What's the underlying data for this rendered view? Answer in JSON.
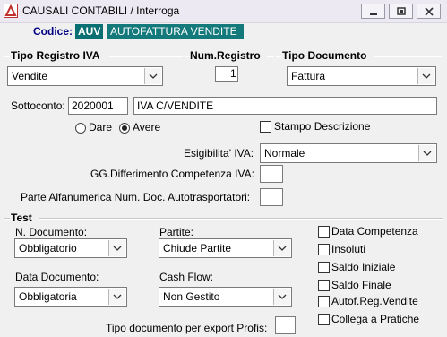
{
  "window": {
    "title": "CAUSALI CONTABILI / Interroga"
  },
  "codice": {
    "label": "Codice:",
    "code": "AUV",
    "description": "AUTOFATTURA VENDITE"
  },
  "tipo_registro": {
    "label": "Tipo Registro IVA",
    "value": "Vendite"
  },
  "num_registro": {
    "label": "Num.Registro",
    "value": "1"
  },
  "tipo_documento": {
    "label": "Tipo Documento",
    "value": "Fattura"
  },
  "sottoconto": {
    "label": "Sottoconto:",
    "code": "2020001",
    "description": "IVA C/VENDITE"
  },
  "dare_avere": {
    "dare": "Dare",
    "avere": "Avere",
    "selected": "avere"
  },
  "stampo_descrizione": {
    "label": "Stampo Descrizione",
    "checked": false
  },
  "esigibilita": {
    "label": "Esigibilita' IVA:",
    "value": "Normale"
  },
  "gg_differimento": {
    "label": "GG.Differimento Competenza IVA:",
    "value": ""
  },
  "parte_alfanumerica": {
    "label": "Parte Alfanumerica Num. Doc. Autotrasportatori:",
    "value": ""
  },
  "test": {
    "label": "Test",
    "n_documento": {
      "label": "N. Documento:",
      "value": "Obbligatorio"
    },
    "partite": {
      "label": "Partite:",
      "value": "Chiude Partite"
    },
    "data_documento": {
      "label": "Data Documento:",
      "value": "Obbligatoria"
    },
    "cash_flow": {
      "label": "Cash Flow:",
      "value": "Non Gestito"
    },
    "tipo_export": {
      "label": "Tipo documento per export Profis:",
      "value": ""
    },
    "checkboxes": [
      {
        "label": "Data Competenza",
        "checked": false
      },
      {
        "label": "Insoluti",
        "checked": false
      },
      {
        "label": "Saldo Iniziale",
        "checked": false
      },
      {
        "label": "Saldo Finale",
        "checked": false
      },
      {
        "label": "Autof.Reg.Vendite",
        "checked": false
      },
      {
        "label": "Collega a Pratiche",
        "checked": false
      }
    ]
  }
}
